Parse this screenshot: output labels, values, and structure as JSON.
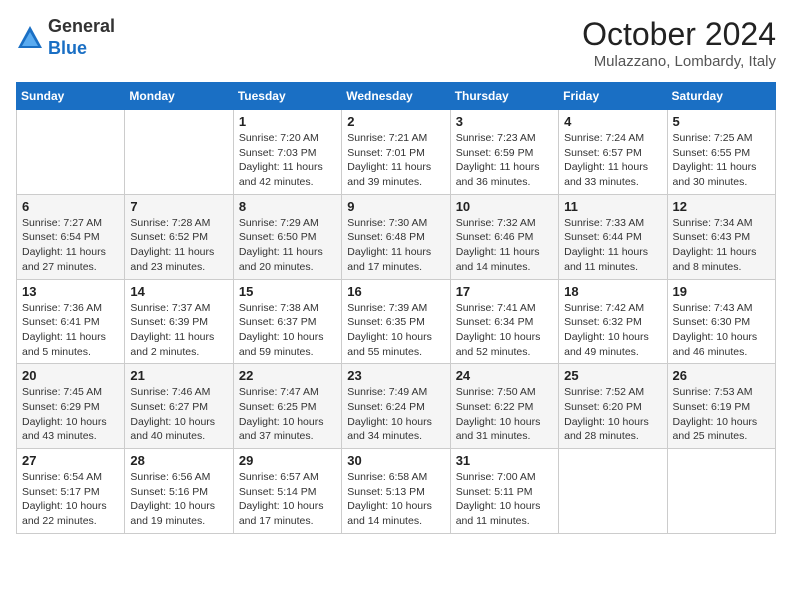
{
  "header": {
    "logo": {
      "general": "General",
      "blue": "Blue"
    },
    "title": "October 2024",
    "location": "Mulazzano, Lombardy, Italy"
  },
  "weekdays": [
    "Sunday",
    "Monday",
    "Tuesday",
    "Wednesday",
    "Thursday",
    "Friday",
    "Saturday"
  ],
  "weeks": [
    [
      {
        "day": null
      },
      {
        "day": null
      },
      {
        "day": "1",
        "sunrise": "Sunrise: 7:20 AM",
        "sunset": "Sunset: 7:03 PM",
        "daylight": "Daylight: 11 hours and 42 minutes."
      },
      {
        "day": "2",
        "sunrise": "Sunrise: 7:21 AM",
        "sunset": "Sunset: 7:01 PM",
        "daylight": "Daylight: 11 hours and 39 minutes."
      },
      {
        "day": "3",
        "sunrise": "Sunrise: 7:23 AM",
        "sunset": "Sunset: 6:59 PM",
        "daylight": "Daylight: 11 hours and 36 minutes."
      },
      {
        "day": "4",
        "sunrise": "Sunrise: 7:24 AM",
        "sunset": "Sunset: 6:57 PM",
        "daylight": "Daylight: 11 hours and 33 minutes."
      },
      {
        "day": "5",
        "sunrise": "Sunrise: 7:25 AM",
        "sunset": "Sunset: 6:55 PM",
        "daylight": "Daylight: 11 hours and 30 minutes."
      }
    ],
    [
      {
        "day": "6",
        "sunrise": "Sunrise: 7:27 AM",
        "sunset": "Sunset: 6:54 PM",
        "daylight": "Daylight: 11 hours and 27 minutes."
      },
      {
        "day": "7",
        "sunrise": "Sunrise: 7:28 AM",
        "sunset": "Sunset: 6:52 PM",
        "daylight": "Daylight: 11 hours and 23 minutes."
      },
      {
        "day": "8",
        "sunrise": "Sunrise: 7:29 AM",
        "sunset": "Sunset: 6:50 PM",
        "daylight": "Daylight: 11 hours and 20 minutes."
      },
      {
        "day": "9",
        "sunrise": "Sunrise: 7:30 AM",
        "sunset": "Sunset: 6:48 PM",
        "daylight": "Daylight: 11 hours and 17 minutes."
      },
      {
        "day": "10",
        "sunrise": "Sunrise: 7:32 AM",
        "sunset": "Sunset: 6:46 PM",
        "daylight": "Daylight: 11 hours and 14 minutes."
      },
      {
        "day": "11",
        "sunrise": "Sunrise: 7:33 AM",
        "sunset": "Sunset: 6:44 PM",
        "daylight": "Daylight: 11 hours and 11 minutes."
      },
      {
        "day": "12",
        "sunrise": "Sunrise: 7:34 AM",
        "sunset": "Sunset: 6:43 PM",
        "daylight": "Daylight: 11 hours and 8 minutes."
      }
    ],
    [
      {
        "day": "13",
        "sunrise": "Sunrise: 7:36 AM",
        "sunset": "Sunset: 6:41 PM",
        "daylight": "Daylight: 11 hours and 5 minutes."
      },
      {
        "day": "14",
        "sunrise": "Sunrise: 7:37 AM",
        "sunset": "Sunset: 6:39 PM",
        "daylight": "Daylight: 11 hours and 2 minutes."
      },
      {
        "day": "15",
        "sunrise": "Sunrise: 7:38 AM",
        "sunset": "Sunset: 6:37 PM",
        "daylight": "Daylight: 10 hours and 59 minutes."
      },
      {
        "day": "16",
        "sunrise": "Sunrise: 7:39 AM",
        "sunset": "Sunset: 6:35 PM",
        "daylight": "Daylight: 10 hours and 55 minutes."
      },
      {
        "day": "17",
        "sunrise": "Sunrise: 7:41 AM",
        "sunset": "Sunset: 6:34 PM",
        "daylight": "Daylight: 10 hours and 52 minutes."
      },
      {
        "day": "18",
        "sunrise": "Sunrise: 7:42 AM",
        "sunset": "Sunset: 6:32 PM",
        "daylight": "Daylight: 10 hours and 49 minutes."
      },
      {
        "day": "19",
        "sunrise": "Sunrise: 7:43 AM",
        "sunset": "Sunset: 6:30 PM",
        "daylight": "Daylight: 10 hours and 46 minutes."
      }
    ],
    [
      {
        "day": "20",
        "sunrise": "Sunrise: 7:45 AM",
        "sunset": "Sunset: 6:29 PM",
        "daylight": "Daylight: 10 hours and 43 minutes."
      },
      {
        "day": "21",
        "sunrise": "Sunrise: 7:46 AM",
        "sunset": "Sunset: 6:27 PM",
        "daylight": "Daylight: 10 hours and 40 minutes."
      },
      {
        "day": "22",
        "sunrise": "Sunrise: 7:47 AM",
        "sunset": "Sunset: 6:25 PM",
        "daylight": "Daylight: 10 hours and 37 minutes."
      },
      {
        "day": "23",
        "sunrise": "Sunrise: 7:49 AM",
        "sunset": "Sunset: 6:24 PM",
        "daylight": "Daylight: 10 hours and 34 minutes."
      },
      {
        "day": "24",
        "sunrise": "Sunrise: 7:50 AM",
        "sunset": "Sunset: 6:22 PM",
        "daylight": "Daylight: 10 hours and 31 minutes."
      },
      {
        "day": "25",
        "sunrise": "Sunrise: 7:52 AM",
        "sunset": "Sunset: 6:20 PM",
        "daylight": "Daylight: 10 hours and 28 minutes."
      },
      {
        "day": "26",
        "sunrise": "Sunrise: 7:53 AM",
        "sunset": "Sunset: 6:19 PM",
        "daylight": "Daylight: 10 hours and 25 minutes."
      }
    ],
    [
      {
        "day": "27",
        "sunrise": "Sunrise: 6:54 AM",
        "sunset": "Sunset: 5:17 PM",
        "daylight": "Daylight: 10 hours and 22 minutes."
      },
      {
        "day": "28",
        "sunrise": "Sunrise: 6:56 AM",
        "sunset": "Sunset: 5:16 PM",
        "daylight": "Daylight: 10 hours and 19 minutes."
      },
      {
        "day": "29",
        "sunrise": "Sunrise: 6:57 AM",
        "sunset": "Sunset: 5:14 PM",
        "daylight": "Daylight: 10 hours and 17 minutes."
      },
      {
        "day": "30",
        "sunrise": "Sunrise: 6:58 AM",
        "sunset": "Sunset: 5:13 PM",
        "daylight": "Daylight: 10 hours and 14 minutes."
      },
      {
        "day": "31",
        "sunrise": "Sunrise: 7:00 AM",
        "sunset": "Sunset: 5:11 PM",
        "daylight": "Daylight: 10 hours and 11 minutes."
      },
      {
        "day": null
      },
      {
        "day": null
      }
    ]
  ]
}
